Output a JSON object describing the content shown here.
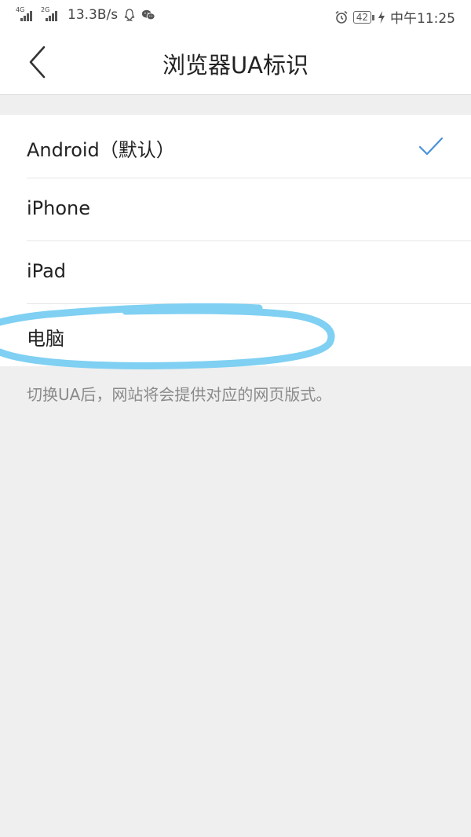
{
  "status_bar": {
    "signal_1_tag": "4G",
    "signal_2_tag": "2G",
    "speed": "13.3B/s",
    "battery": "42",
    "time": "中午11:25",
    "icons": [
      "signal-icon",
      "qq-icon",
      "wechat-icon",
      "alarm-icon",
      "battery-icon",
      "charging-icon"
    ]
  },
  "header": {
    "title": "浏览器UA标识",
    "back_icon": "chevron-left-icon"
  },
  "ua_options": {
    "items": [
      {
        "label": "Android（默认）",
        "selected": true
      },
      {
        "label": "iPhone",
        "selected": false
      },
      {
        "label": "iPad",
        "selected": false
      },
      {
        "label": "电脑",
        "selected": false
      }
    ],
    "selected_icon": "checkmark-icon"
  },
  "hint": "切换UA后，网站将会提供对应的网页版式。",
  "colors": {
    "accent": "#4a90d9",
    "annotation": "#7fd0f2",
    "background": "#efefef",
    "hint_text": "#8a8a8a"
  }
}
